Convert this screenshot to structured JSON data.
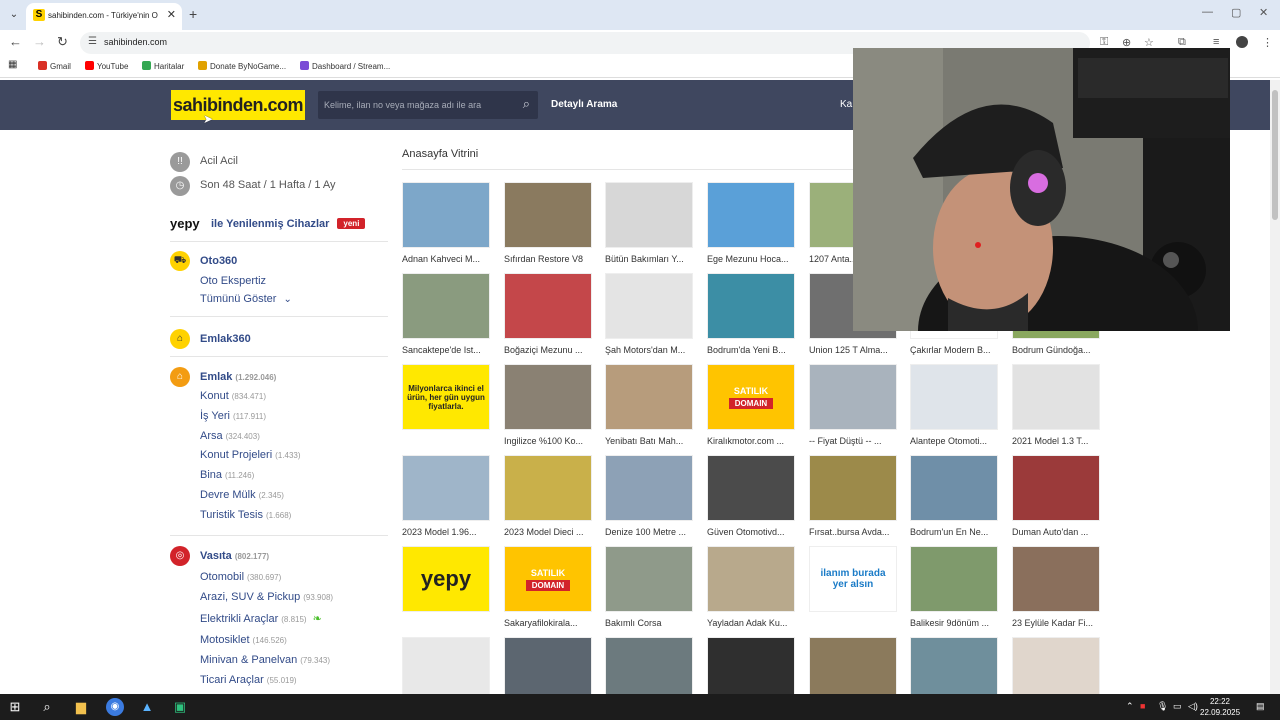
{
  "browser": {
    "tab_title": "sahibinden.com - Türkiye'nin O",
    "tab_favicon": "S",
    "url": "sahibinden.com",
    "bookmarks": [
      {
        "label": "Gmail",
        "icon": "gmail-icon",
        "color": "#d93025"
      },
      {
        "label": "YouTube",
        "icon": "youtube-icon",
        "color": "#ff0000"
      },
      {
        "label": "Haritalar",
        "icon": "maps-icon",
        "color": "#34a853"
      },
      {
        "label": "Donate ByNoGame...",
        "icon": "donate-icon",
        "color": "#e0a100"
      },
      {
        "label": "Dashboard / Stream...",
        "icon": "dashboard-icon",
        "color": "#7b4bd6"
      }
    ]
  },
  "header": {
    "logo": "sahibinden.com",
    "search_placeholder": "Kelime, ilan no veya mağaza adı ile ara",
    "detail_search": "Detaylı Arama",
    "truncated_item": "Ka"
  },
  "sidebar": {
    "acil": "Acil Acil",
    "son48": "Son 48 Saat / 1 Hafta / 1 Ay",
    "yepy_brand": "yepy",
    "yepy_text": "ile Yenilenmiş Cihazlar",
    "yeni_badge": "yeni",
    "oto360": "Oto360",
    "oto_ekspertiz": "Oto Ekspertiz",
    "tumunu_goster": "Tümünü Göster",
    "emlak360": "Emlak360",
    "emlak": {
      "label": "Emlak",
      "count": "(1.292.046)"
    },
    "emlak_items": [
      {
        "label": "Konut",
        "count": "(834.471)"
      },
      {
        "label": "İş Yeri",
        "count": "(117.911)"
      },
      {
        "label": "Arsa",
        "count": "(324.403)"
      },
      {
        "label": "Konut Projeleri",
        "count": "(1.433)"
      },
      {
        "label": "Bina",
        "count": "(11.246)"
      },
      {
        "label": "Devre Mülk",
        "count": "(2.345)"
      },
      {
        "label": "Turistik Tesis",
        "count": "(1.668)"
      }
    ],
    "vasita": {
      "label": "Vasıta",
      "count": "(802.177)"
    },
    "vasita_items": [
      {
        "label": "Otomobil",
        "count": "(380.697)"
      },
      {
        "label": "Arazi, SUV & Pickup",
        "count": "(93.908)"
      },
      {
        "label": "Elektrikli Araçlar",
        "count": "(8.815)"
      },
      {
        "label": "Motosiklet",
        "count": "(146.526)"
      },
      {
        "label": "Minivan & Panelvan",
        "count": "(79.343)"
      },
      {
        "label": "Ticari Araçlar",
        "count": "(55.019)"
      }
    ]
  },
  "vitrin": {
    "title": "Anasayfa Vitrini",
    "items": [
      {
        "caption": "Adnan Kahveci M...",
        "color": "#7da7c9"
      },
      {
        "caption": "Sıfırdan Restore V8",
        "color": "#8a7a5f"
      },
      {
        "caption": "Bütün Bakımları Y...",
        "color": "#d7d7d7"
      },
      {
        "caption": "Ege Mezunu Hoca...",
        "color": "#5aa0d8"
      },
      {
        "caption": "1207 Anta...",
        "color": "#9bb07a"
      },
      {
        "caption": "",
        "color": "#ffffff"
      },
      {
        "caption": "",
        "color": "#ffffff"
      },
      {
        "caption": "Sancaktepe'de Ist...",
        "color": "#8a9b7f"
      },
      {
        "caption": "Boğaziçi Mezunu ...",
        "color": "#c4474a"
      },
      {
        "caption": "Şah Motors'dan M...",
        "color": "#e4e4e4"
      },
      {
        "caption": "Bodrum'da Yeni B...",
        "color": "#3c8ea5"
      },
      {
        "caption": "Union 125 T Alma...",
        "color": "#6f6f6f"
      },
      {
        "caption": "Çakırlar Modern B...",
        "color": "#ffffff"
      },
      {
        "caption": "Bodrum Gündoğa...",
        "color": "#8aa85f"
      },
      {
        "caption": "Milyonlarca ikinci el ürün, her gün uygun fiyatlarla.",
        "color": "#ffe800"
      },
      {
        "caption": "Ingilizce %100 Ko...",
        "color": "#8a8173"
      },
      {
        "caption": "Yenibatı Batı Mah...",
        "color": "#b79c7c"
      },
      {
        "caption": "Kiralıkmotor.com ...",
        "color": "#ffc400"
      },
      {
        "caption": "-- Fiyat Düştü -- ...",
        "color": "#a9b3bd"
      },
      {
        "caption": "Alantepe Otomoti...",
        "color": "#dfe4ea"
      },
      {
        "caption": "2021 Model 1.3 T...",
        "color": "#e2e2e2"
      },
      {
        "caption": "2023 Model 1.96...",
        "color": "#9fb5c9"
      },
      {
        "caption": "2023 Model Dieci ...",
        "color": "#c9b04a"
      },
      {
        "caption": "Denize 100 Metre ...",
        "color": "#8da1b6"
      },
      {
        "caption": "Güven Otomotivd...",
        "color": "#4b4b4b"
      },
      {
        "caption": "Fırsat..bursa Avda...",
        "color": "#9c8a4a"
      },
      {
        "caption": "Bodrum'un En Ne...",
        "color": "#6f8fa8"
      },
      {
        "caption": "Duman Auto'dan ...",
        "color": "#9b3a3a"
      },
      {
        "caption": "yepy",
        "color": "#ffe800"
      },
      {
        "caption": "Sakaryafilokirala...",
        "color": "#ffc400"
      },
      {
        "caption": "Bakımlı Corsa",
        "color": "#8f9a8a"
      },
      {
        "caption": "Yayladan Adak Ku...",
        "color": "#b8a98c"
      },
      {
        "caption": "",
        "color": "#ffffff"
      },
      {
        "caption": "Balikesir 9dönüm ...",
        "color": "#7f9a6c"
      },
      {
        "caption": "23 Eylüle Kadar Fi...",
        "color": "#8a6f5c"
      },
      {
        "caption": "",
        "color": "#e8e8e8"
      },
      {
        "caption": "",
        "color": "#5c6670"
      },
      {
        "caption": "",
        "color": "#6c7a7e"
      },
      {
        "caption": "",
        "color": "#2f2f2f"
      },
      {
        "caption": "",
        "color": "#8b7a5c"
      },
      {
        "caption": "",
        "color": "#6f8f9c"
      },
      {
        "caption": "",
        "color": "#e0d6cc"
      }
    ],
    "satilik_label": "SATILIK",
    "domain_label": "DOMAIN",
    "ilan_text": "ilanım burada yer alsın"
  },
  "taskbar": {
    "time": "22:22",
    "date": "22.09.2025"
  },
  "colors": {
    "header_bg": "#3f475f",
    "logo_bg": "#ffe800",
    "link": "#324b88",
    "accent_red": "#d2232a"
  }
}
